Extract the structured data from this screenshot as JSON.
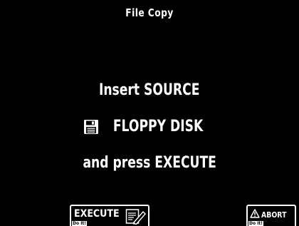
{
  "screen": {
    "title": "File Copy",
    "message": {
      "line1": "Insert SOURCE",
      "line2": "FLOPPY DISK",
      "line3": "and press EXECUTE"
    },
    "icons": {
      "floppy": "floppy-disk-icon",
      "pen": "pen-and-paper-icon",
      "warning": "warning-triangle-icon"
    }
  },
  "buttons": {
    "execute": {
      "label": "EXECUTE",
      "sublabel": "Do It!"
    },
    "abort": {
      "label": "ABORT",
      "sublabel": "Do It!"
    }
  },
  "colors": {
    "background": "#000000",
    "foreground": "#ffffff"
  }
}
